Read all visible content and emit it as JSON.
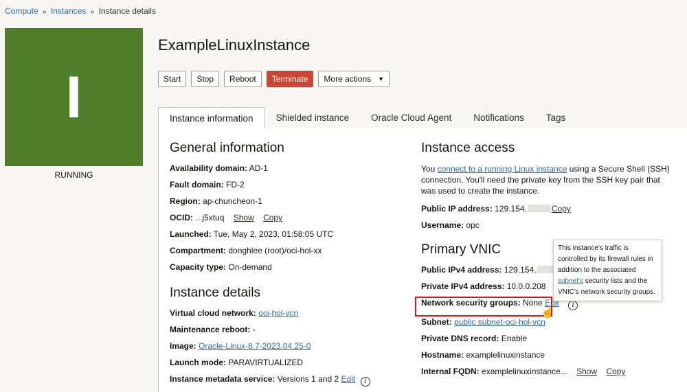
{
  "breadcrumb": [
    {
      "label": "Compute"
    },
    {
      "label": "Instances"
    },
    {
      "label": "Instance details"
    }
  ],
  "breadcrumb_separator": "»",
  "instance": {
    "title": "ExampleLinuxInstance",
    "state_letter": "I",
    "state": "RUNNING",
    "state_color": "#4f7d2a"
  },
  "actions": {
    "start": "Start",
    "stop": "Stop",
    "reboot": "Reboot",
    "terminate": "Terminate",
    "more": "More actions",
    "terminate_color": "#c74634"
  },
  "tabs": [
    "Instance information",
    "Shielded instance",
    "Oracle Cloud Agent",
    "Notifications",
    "Tags"
  ],
  "general": {
    "heading": "General information",
    "availability_domain": {
      "key": "Availability domain:",
      "value": "AD-1"
    },
    "fault_domain": {
      "key": "Fault domain:",
      "value": "FD-2"
    },
    "region": {
      "key": "Region:",
      "value": "ap-chuncheon-1"
    },
    "ocid": {
      "key": "OCID:",
      "value": "...j5xtuq",
      "show": "Show",
      "copy": "Copy"
    },
    "launched": {
      "key": "Launched:",
      "value": "Tue, May 2, 2023, 01:58:05 UTC"
    },
    "compartment": {
      "key": "Compartment:",
      "value": "donghlee (root)/oci-hol-xx"
    },
    "capacity_type": {
      "key": "Capacity type:",
      "value": "On-demand"
    }
  },
  "details": {
    "heading": "Instance details",
    "vcn": {
      "key": "Virtual cloud network:",
      "value": "oci-hol-vcn"
    },
    "maintenance": {
      "key": "Maintenance reboot:",
      "value": "-"
    },
    "image": {
      "key": "Image:",
      "value": "Oracle-Linux-8.7-2023.04.25-0"
    },
    "launch_mode": {
      "key": "Launch mode:",
      "value": "PARAVIRTUALIZED"
    },
    "metadata_service": {
      "key": "Instance metadata service:",
      "value": "Versions 1 and 2",
      "edit": "Edit"
    }
  },
  "access": {
    "heading": "Instance access",
    "intro_prefix": "You ",
    "intro_link": "connect to a running Linux instance",
    "intro_suffix": " using a Secure Shell (SSH) connection. You'll need the private key from the SSH key pair that was used to create the instance.",
    "public_ip": {
      "key": "Public IP address:",
      "value": "129.154.",
      "copy": "Copy"
    },
    "username": {
      "key": "Username:",
      "value": "opc"
    }
  },
  "vnic": {
    "heading": "Primary VNIC",
    "public_ipv4": {
      "key": "Public IPv4 address:",
      "value": "129.154."
    },
    "private_ipv4": {
      "key": "Private IPv4 address:",
      "value": "10.0.0.208"
    },
    "nsg": {
      "key": "Network security groups:",
      "value": "None",
      "edit": "Edit"
    },
    "subnet": {
      "key": "Subnet:",
      "value": "public subnet-oci-hol-vcn"
    },
    "private_dns": {
      "key": "Private DNS record:",
      "value": "Enable"
    },
    "hostname": {
      "key": "Hostname:",
      "value": "examplelinuxinstance"
    },
    "fqdn": {
      "key": "Internal FQDN:",
      "value": "examplelinuxinstance...",
      "show": "Show",
      "copy": "Copy"
    }
  },
  "tooltip": {
    "prefix": "This instance's traffic is controlled by its firewall rules in addition to the associated ",
    "link": "subnet's",
    "suffix": " security lists and the VNIC's network security groups."
  },
  "icons": {
    "info": "i",
    "cursor": "☝",
    "caret": "▼"
  },
  "highlight_color": "#e0120f"
}
